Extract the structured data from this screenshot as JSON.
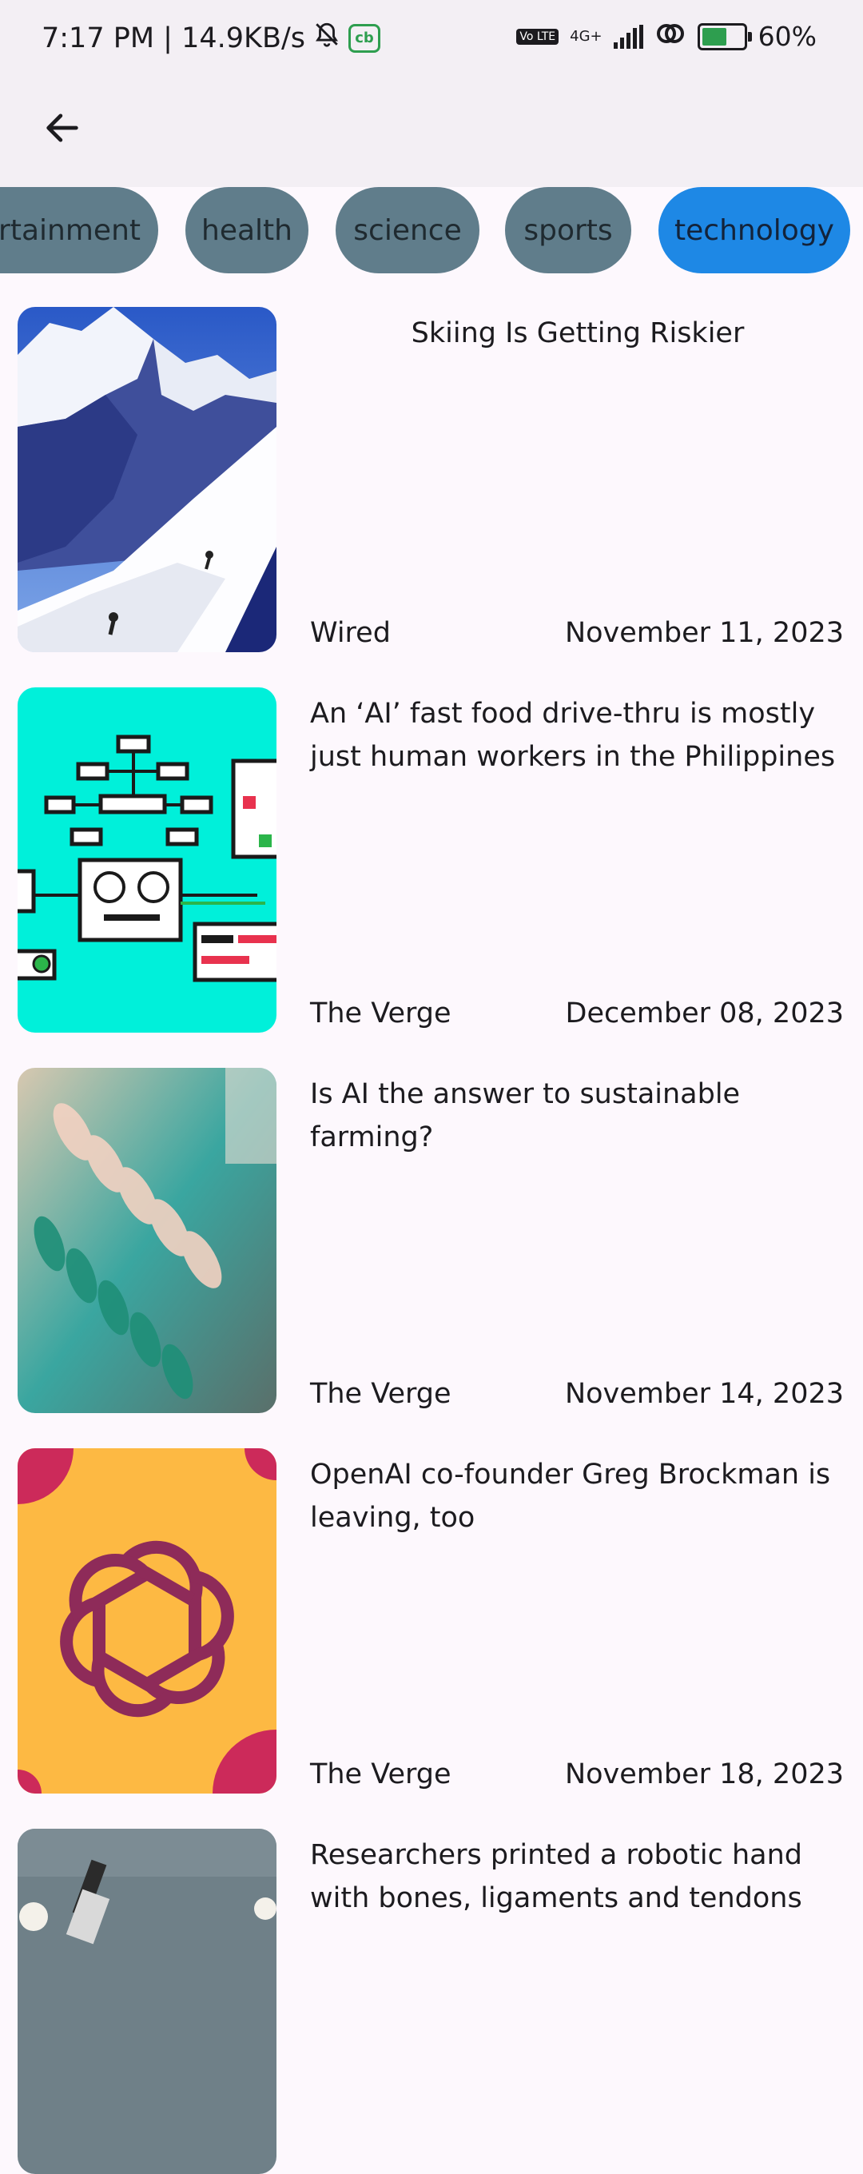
{
  "status_bar": {
    "time_speed": "7:17 PM | 14.9KB/s",
    "app_badge": "cb",
    "volte": "Vo LTE",
    "network": "4G+",
    "battery": "60%"
  },
  "app_bar": {
    "back_icon": "arrow-left-icon"
  },
  "categories": [
    {
      "label": "entertainment",
      "active": false
    },
    {
      "label": "health",
      "active": false
    },
    {
      "label": "science",
      "active": false
    },
    {
      "label": "sports",
      "active": false
    },
    {
      "label": "technology",
      "active": true
    }
  ],
  "articles": [
    {
      "title": "Skiing Is Getting Riskier",
      "source": "Wired",
      "date": "November 11, 2023"
    },
    {
      "title": "An ‘AI’ fast food drive-thru is mostly just human workers in the Philippines",
      "source": "The Verge",
      "date": "December 08, 2023"
    },
    {
      "title": "Is AI the answer to sustainable farming?",
      "source": "The Verge",
      "date": "November 14, 2023"
    },
    {
      "title": "OpenAI co-founder Greg Brockman is leaving, too",
      "source": "The Verge",
      "date": "November 18, 2023"
    },
    {
      "title": "Researchers printed a robotic hand with bones, ligaments and tendons",
      "source": "",
      "date": ""
    }
  ]
}
